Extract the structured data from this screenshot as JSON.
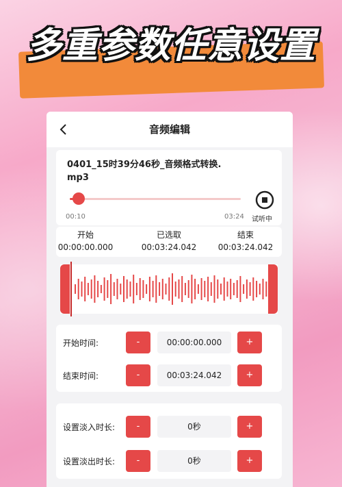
{
  "banner": {
    "title": "多重参数任意设置"
  },
  "nav": {
    "title": "音频编辑"
  },
  "file": {
    "name": "0401_15时39分46秒_音频格式转换.mp3",
    "current_time": "00:10",
    "total_time": "03:24",
    "progress": 0.05,
    "preview_label": "试听中"
  },
  "selection": {
    "start_label": "开始",
    "start_value": "00:00:00.000",
    "selected_label": "已选取",
    "selected_value": "00:03:24.042",
    "end_label": "结束",
    "end_value": "00:03:24.042"
  },
  "params": {
    "start_time": {
      "label": "开始时间:",
      "value": "00:00:00.000"
    },
    "end_time": {
      "label": "结束时间:",
      "value": "00:03:24.042"
    },
    "fade_in": {
      "label": "设置淡入时长:",
      "value": "0秒"
    },
    "fade_out": {
      "label": "设置淡出时长:",
      "value": "0秒"
    },
    "minus_label": "-",
    "plus_label": "+"
  },
  "colors": {
    "accent": "#e54848",
    "banner_stripe": "#f28a3a"
  }
}
